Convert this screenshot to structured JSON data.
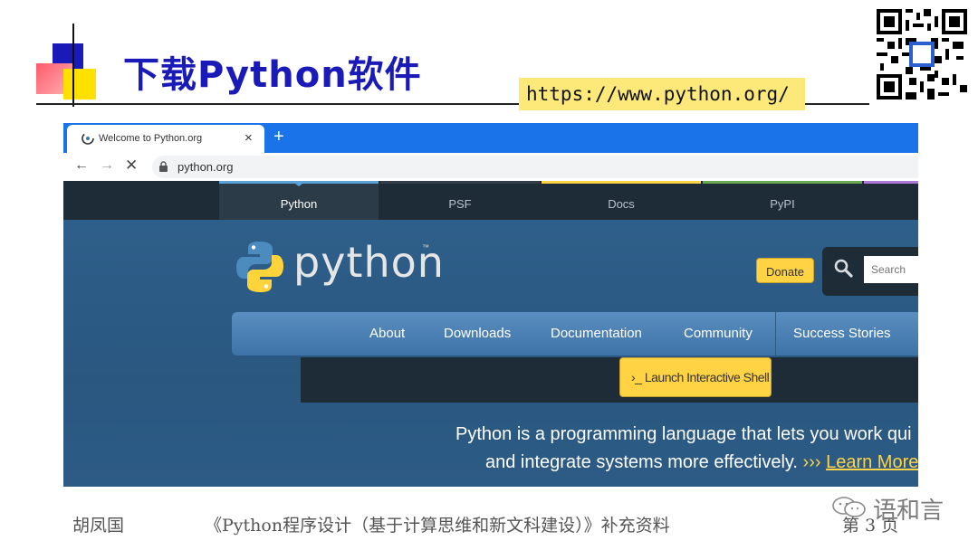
{
  "slide": {
    "title": "下载Python软件",
    "url_badge": "https://www.python.org/",
    "footer_author": "胡凤国",
    "footer_book": "《Python程序设计（基于计算思维和新文科建设）》补充资料",
    "footer_page": "第  3  页",
    "watermark": "语和言"
  },
  "browser": {
    "tab_title": "Welcome to Python.org",
    "tab_close": "×",
    "new_tab": "+",
    "back": "←",
    "forward": "→",
    "stop": "✕",
    "address": "python.org"
  },
  "site": {
    "top_nav": [
      "Python",
      "PSF",
      "Docs",
      "PyPI"
    ],
    "top_nav_active": "Python",
    "top_nav_colors": [
      "#5aa3d8",
      "#333e48",
      "#ffd343",
      "#6aa84f"
    ],
    "logo_text": "python",
    "logo_tm": "™",
    "donate": "Donate",
    "search_placeholder": "Search",
    "main_nav": [
      "About",
      "Downloads",
      "Documentation",
      "Community",
      "Success Stories"
    ],
    "shell_button": "›_ Launch Interactive Shell",
    "intro_line1": "Python is a programming language that lets you work qui",
    "intro_line2": "and integrate systems more effectively.",
    "intro_arrows": "›››",
    "learn_more": "Learn More"
  },
  "colors": {
    "title": "#1a1ab8",
    "chrome_tabbar": "#1a73e8",
    "python_blue": "#2b5b84",
    "python_yellow": "#ffd343"
  }
}
